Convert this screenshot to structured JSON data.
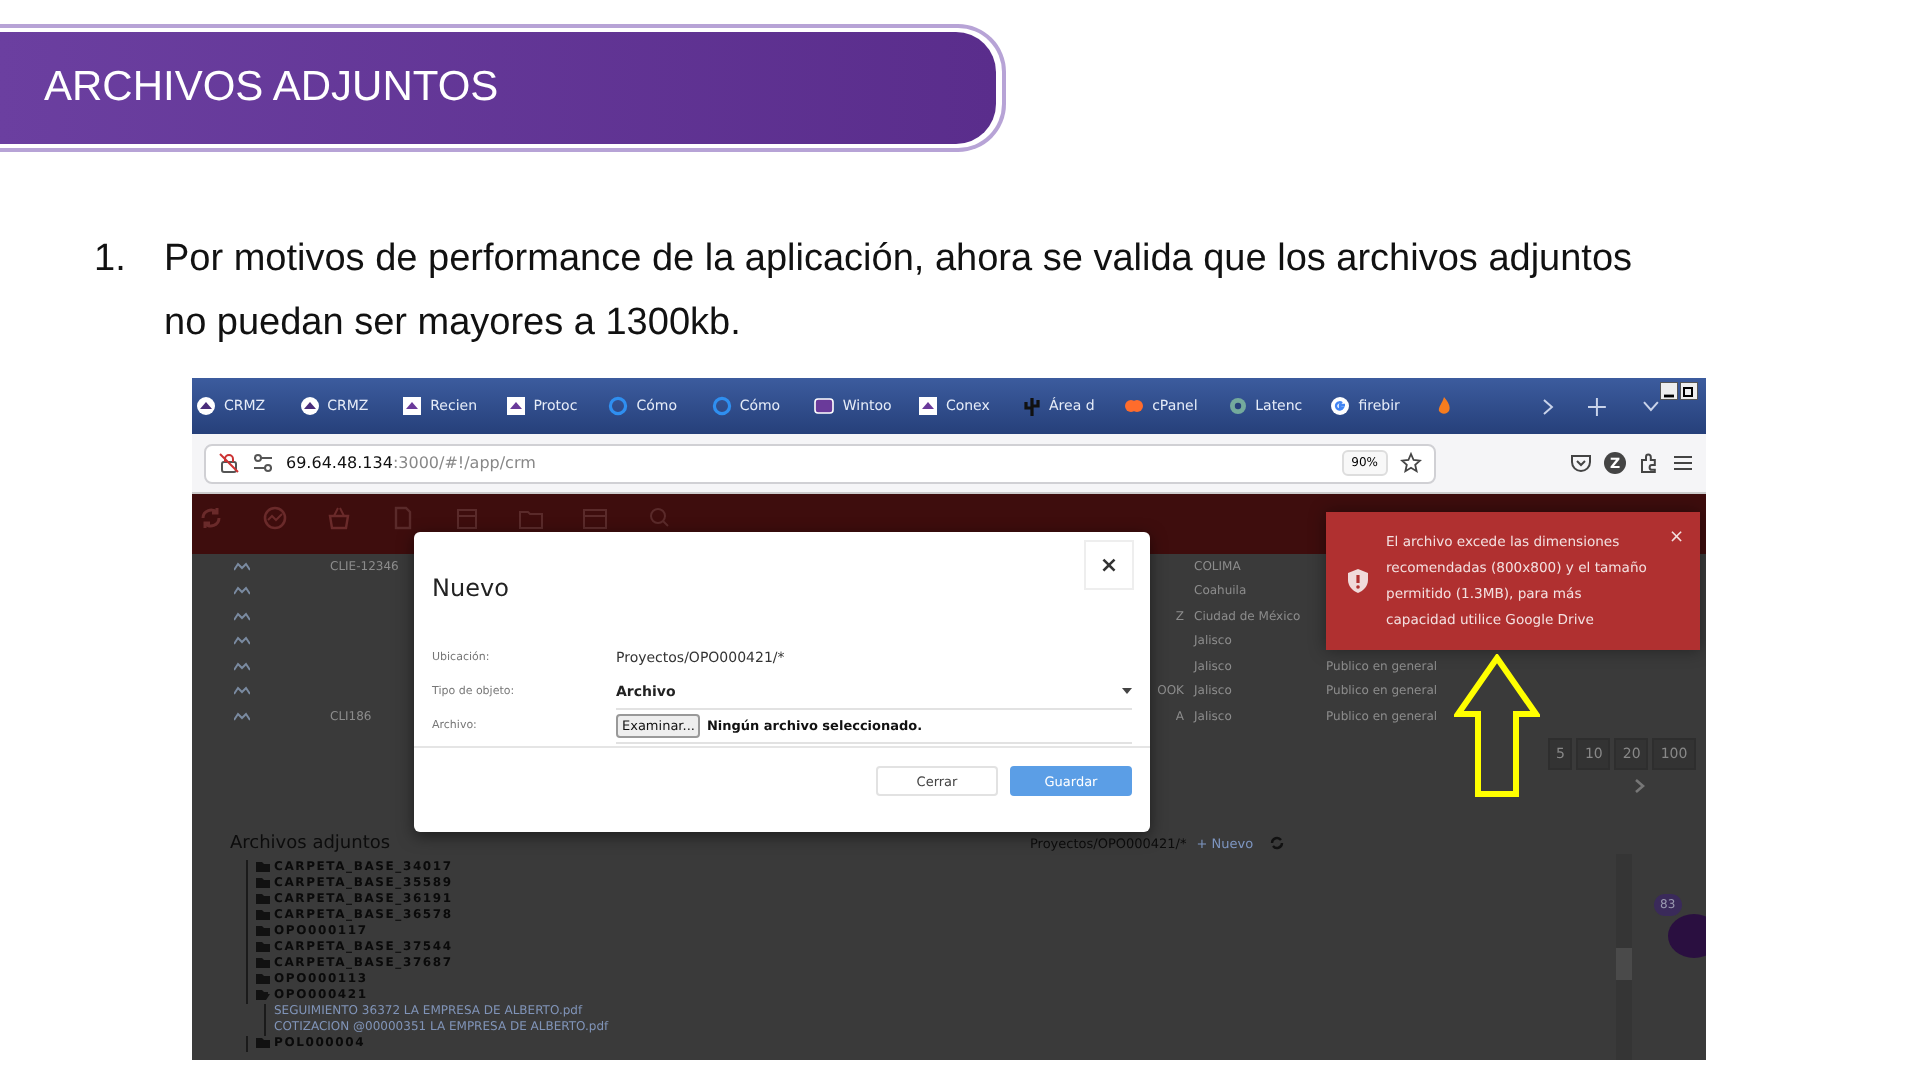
{
  "slide": {
    "title": "ARCHIVOS ADJUNTOS",
    "list_number": "1.",
    "paragraph": "Por motivos de performance de la aplicación, ahora se valida que los archivos adjuntos no puedan ser mayores a 1300kb."
  },
  "browser": {
    "tabs": [
      {
        "label": "CRMZ",
        "kind": "crm"
      },
      {
        "label": "CRMZ",
        "kind": "crm"
      },
      {
        "label": "Recien",
        "kind": "doc"
      },
      {
        "label": "Protoc",
        "kind": "doc"
      },
      {
        "label": "Cómo",
        "kind": "ring"
      },
      {
        "label": "Cómo",
        "kind": "ring"
      },
      {
        "label": "Wintoo",
        "kind": "app"
      },
      {
        "label": "Conex",
        "kind": "doc"
      },
      {
        "label": "Área d",
        "kind": "cactus"
      },
      {
        "label": "cPanel",
        "kind": "cpanel"
      },
      {
        "label": "Latenc",
        "kind": "gear"
      },
      {
        "label": "firebir",
        "kind": "google"
      },
      {
        "kind": "flame"
      }
    ],
    "url_host": "69.64.48.134",
    "url_path": ":3000/#!/app/crm",
    "zoom": "90%",
    "account_initial": "Z"
  },
  "app": {
    "rows": [
      {
        "client": "CLIE-12346",
        "column_3": "",
        "state": "COLIMA",
        "segment": ""
      },
      {
        "client": "",
        "column_3": "",
        "state": "Coahuila",
        "segment": ""
      },
      {
        "client": "",
        "column_3": "Z",
        "state": "Ciudad de México",
        "segment": ""
      },
      {
        "client": "",
        "column_3": "",
        "state": "Jalisco",
        "segment": ""
      },
      {
        "client": "",
        "column_3": "",
        "state": "Jalisco",
        "segment": "Publico en general"
      },
      {
        "client": "",
        "column_3": "OOK",
        "state": "Jalisco",
        "segment": "Publico en general"
      },
      {
        "client": "CLI186",
        "column_3": "A",
        "state": "Jalisco",
        "segment": "Publico en general"
      }
    ],
    "pagination": [
      "5",
      "10",
      "20",
      "100"
    ],
    "attachments": {
      "title": "Archivos adjuntos",
      "path": "Proyectos/OPO000421/*",
      "new_link": "+ Nuevo",
      "tree": [
        {
          "label": "CARPETA_BASE_34017",
          "kind": "folder",
          "expanded": false
        },
        {
          "label": "CARPETA_BASE_35589",
          "kind": "folder",
          "expanded": false
        },
        {
          "label": "CARPETA_BASE_36191",
          "kind": "folder",
          "expanded": false
        },
        {
          "label": "CARPETA_BASE_36578",
          "kind": "folder",
          "expanded": false
        },
        {
          "label": "OPO000117",
          "kind": "folder",
          "expanded": false
        },
        {
          "label": "CARPETA_BASE_37544",
          "kind": "folder",
          "expanded": false
        },
        {
          "label": "CARPETA_BASE_37687",
          "kind": "folder",
          "expanded": false
        },
        {
          "label": "OPO000113",
          "kind": "folder",
          "expanded": false
        },
        {
          "label": "OPO000421",
          "kind": "folder",
          "expanded": true,
          "children": [
            {
              "label": "SEGUIMIENTO 36372 LA EMPRESA DE ALBERTO.pdf",
              "kind": "file"
            },
            {
              "label": "COTIZACION @00000351 LA EMPRESA DE ALBERTO.pdf",
              "kind": "file"
            }
          ]
        },
        {
          "label": "POL000004",
          "kind": "folder",
          "expanded": false
        }
      ]
    },
    "badge": "83"
  },
  "modal": {
    "title": "Nuevo",
    "close": "×",
    "fields": [
      {
        "label": "Ubicación:",
        "kind": "text",
        "value": "Proyectos/OPO000421/*"
      },
      {
        "label": "Tipo de objeto:",
        "kind": "select",
        "value": "Archivo"
      },
      {
        "label": "Archivo:",
        "kind": "file",
        "button": "Examinar...",
        "value": "Ningún archivo seleccionado."
      }
    ],
    "buttons": [
      {
        "label": "Cerrar",
        "kind": "secondary"
      },
      {
        "label": "Guardar",
        "kind": "primary"
      }
    ]
  },
  "toast": {
    "message": "El archivo excede las dimensiones recomendadas (800x800) y el tamaño permitido (1.3MB), para más capacidad utilice Google Drive",
    "close": "×"
  }
}
